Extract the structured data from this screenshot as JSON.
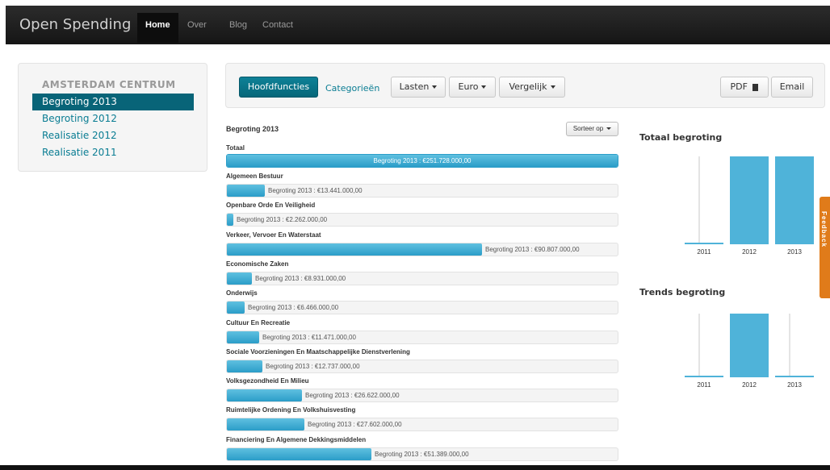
{
  "nav": {
    "brand": "Open Spending",
    "links": [
      "Home",
      "Over",
      "Blog",
      "Contact"
    ]
  },
  "sidebar": {
    "header": "AMSTERDAM CENTRUM",
    "items": [
      "Begroting 2013",
      "Begroting 2012",
      "Realisatie 2012",
      "Realisatie 2011"
    ]
  },
  "toolbar": {
    "hoofdfuncties": "Hoofdfuncties",
    "categorieen": "Categorieën",
    "lasten": "Lasten",
    "euro": "Euro",
    "vergelijk": "Vergelijk",
    "pdf": "PDF",
    "email": "Email"
  },
  "main": {
    "title": "Begroting 2013",
    "sort": "Sorteer op",
    "total_label": "Totaal",
    "total_text": "Begroting 2013 : €251.728.000,00"
  },
  "rows": [
    {
      "label": "Algemeen Bestuur",
      "text": "Begroting 2013 : €13.441.000,00",
      "value": 13441000
    },
    {
      "label": "Openbare Orde En Veiligheid",
      "text": "Begroting 2013 : €2.262.000,00",
      "value": 2262000
    },
    {
      "label": "Verkeer, Vervoer En Waterstaat",
      "text": "Begroting 2013 : €90.807.000,00",
      "value": 90807000
    },
    {
      "label": "Economische Zaken",
      "text": "Begroting 2013 : €8.931.000,00",
      "value": 8931000
    },
    {
      "label": "Onderwijs",
      "text": "Begroting 2013 : €6.466.000,00",
      "value": 6466000
    },
    {
      "label": "Cultuur En Recreatie",
      "text": "Begroting 2013 : €11.471.000,00",
      "value": 11471000
    },
    {
      "label": "Sociale Voorzieningen En Maatschappelijke Dienstverlening",
      "text": "Begroting 2013 : €12.737.000,00",
      "value": 12737000
    },
    {
      "label": "Volksgezondheid En Milieu",
      "text": "Begroting 2013 : €26.622.000,00",
      "value": 26622000
    },
    {
      "label": "Ruimtelijke Ordening En Volkshuisvesting",
      "text": "Begroting 2013 : €27.602.000,00",
      "value": 27602000
    },
    {
      "label": "Financiering En Algemene Dekkingsmiddelen",
      "text": "Begroting 2013 : €51.389.000,00",
      "value": 51389000
    }
  ],
  "total_value": 251728000,
  "charts": {
    "totaal_title": "Totaal begroting",
    "trends_title": "Trends begroting"
  },
  "chart_data": [
    {
      "type": "bar",
      "title": "Totaal begroting",
      "categories": [
        "2011",
        "2012",
        "2013"
      ],
      "values": [
        0,
        1,
        1
      ]
    },
    {
      "type": "bar",
      "title": "Trends begroting",
      "categories": [
        "2011",
        "2012",
        "2013"
      ],
      "values": [
        0,
        1,
        0
      ]
    }
  ],
  "feedback": "Feedback",
  "colors": {
    "accent": "#086478",
    "bar": "#4fb3d9",
    "feedback": "#e07b1a"
  }
}
